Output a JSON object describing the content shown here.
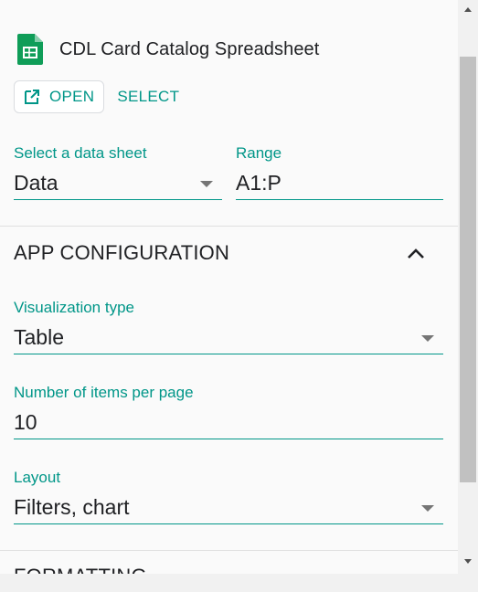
{
  "source": {
    "icon": "google-sheets-icon",
    "title": "CDL Card Catalog Spreadsheet",
    "open_label": "OPEN",
    "select_label": "SELECT"
  },
  "data_sheet": {
    "label": "Select a data sheet",
    "value": "Data"
  },
  "range": {
    "label": "Range",
    "value": "A1:P"
  },
  "app_configuration": {
    "title": "APP CONFIGURATION",
    "visualization_type": {
      "label": "Visualization type",
      "value": "Table"
    },
    "items_per_page": {
      "label": "Number of items per page",
      "value": "10"
    },
    "layout": {
      "label": "Layout",
      "value": "Filters, chart"
    }
  },
  "formatting": {
    "title": "FORMATTING"
  },
  "colors": {
    "accent": "#009688",
    "sheets_green": "#0f9d58",
    "text": "#202124"
  }
}
